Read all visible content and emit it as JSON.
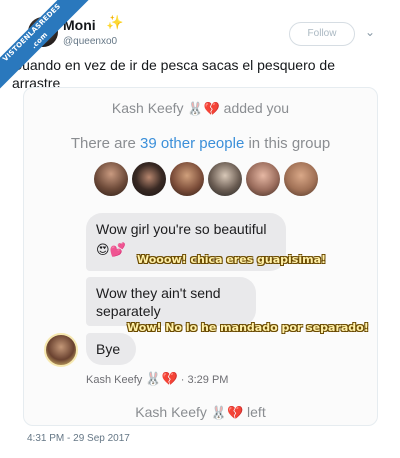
{
  "watermark": {
    "line1": "VISTOENLASREDES",
    "line2": ".com"
  },
  "tweet": {
    "display_name": "Moni",
    "sparkle_glyph": "✨",
    "handle": "@queenxo0",
    "follow_label": "Follow",
    "chevron_glyph": "⌄",
    "text": "Cuando en vez de ir de pesca sacas el pesquero de arrastre",
    "timestamp": "4:31 PM - 29 Sep 2017"
  },
  "screenshot": {
    "added_name": "Kash Keefy",
    "added_suffix": "added you",
    "people_prefix": "There are",
    "people_link": "39 other people",
    "people_suffix": "in this group",
    "rabbit_glyph": "🐰",
    "heart_glyph": "💔",
    "bubble1_text": "Wow girl you're so beautiful",
    "bubble1_emoji": "😍💕",
    "bubble2_text": "Wow they ain't send separately",
    "bubble3_text": "Bye",
    "meta_name": "Kash Keefy",
    "meta_time": "· 3:29 PM",
    "left_name": "Kash Keefy",
    "left_suffix": "left"
  },
  "captions": {
    "caption1": "Wooow! chica eres guapisima!",
    "caption2": "Wow! No lo he mandado por separado!"
  },
  "colors": {
    "link_blue": "#3b8fd9",
    "bubble_gray": "#e9e9eb",
    "ribbon_blue": "#2a78bd"
  }
}
